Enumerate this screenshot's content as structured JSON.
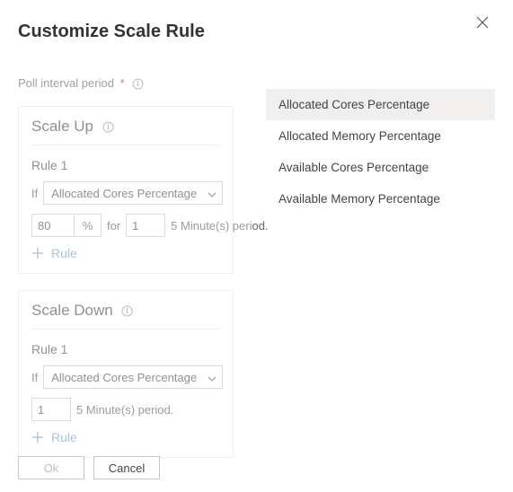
{
  "header": {
    "title": "Customize Scale Rule"
  },
  "poll": {
    "label": "Poll interval period",
    "required_marker": "*"
  },
  "scale_up": {
    "heading": "Scale Up",
    "rule_label": "Rule 1",
    "if_label": "If",
    "metric": "Allocated Cores Percentage",
    "threshold": "80",
    "percent_sign": "%",
    "for_label": "for",
    "period_value": "1",
    "period_text": "5 Minute(s) period.",
    "add_rule": "Rule"
  },
  "scale_down": {
    "heading": "Scale Down",
    "rule_label": "Rule 1",
    "if_label": "If",
    "metric": "Allocated Cores Percentage",
    "period_value": "1",
    "period_text": "5 Minute(s) period.",
    "add_rule": "Rule"
  },
  "footer": {
    "ok": "Ok",
    "cancel": "Cancel"
  },
  "dropdown": {
    "options": [
      "Allocated Cores Percentage",
      "Allocated Memory Percentage",
      "Available Cores Percentage",
      "Available Memory Percentage"
    ]
  }
}
